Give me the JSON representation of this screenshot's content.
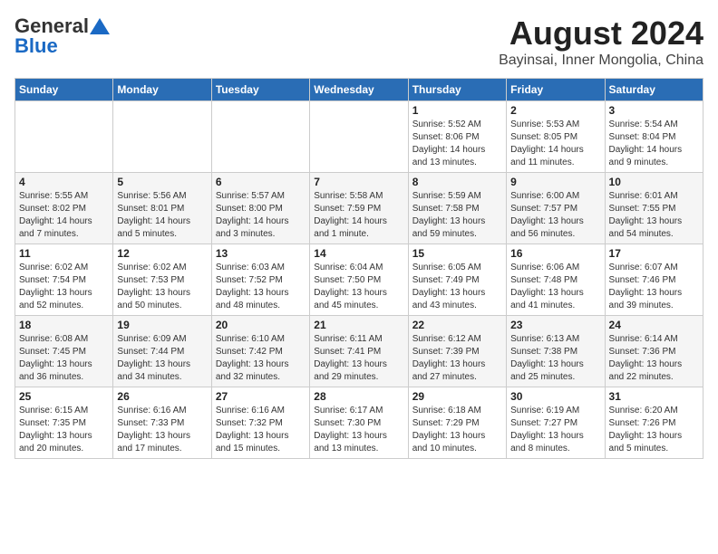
{
  "header": {
    "logo_general": "General",
    "logo_blue": "Blue",
    "title": "August 2024",
    "location": "Bayinsai, Inner Mongolia, China"
  },
  "weekdays": [
    "Sunday",
    "Monday",
    "Tuesday",
    "Wednesday",
    "Thursday",
    "Friday",
    "Saturday"
  ],
  "weeks": [
    [
      {
        "day": "",
        "info": ""
      },
      {
        "day": "",
        "info": ""
      },
      {
        "day": "",
        "info": ""
      },
      {
        "day": "",
        "info": ""
      },
      {
        "day": "1",
        "info": "Sunrise: 5:52 AM\nSunset: 8:06 PM\nDaylight: 14 hours\nand 13 minutes."
      },
      {
        "day": "2",
        "info": "Sunrise: 5:53 AM\nSunset: 8:05 PM\nDaylight: 14 hours\nand 11 minutes."
      },
      {
        "day": "3",
        "info": "Sunrise: 5:54 AM\nSunset: 8:04 PM\nDaylight: 14 hours\nand 9 minutes."
      }
    ],
    [
      {
        "day": "4",
        "info": "Sunrise: 5:55 AM\nSunset: 8:02 PM\nDaylight: 14 hours\nand 7 minutes."
      },
      {
        "day": "5",
        "info": "Sunrise: 5:56 AM\nSunset: 8:01 PM\nDaylight: 14 hours\nand 5 minutes."
      },
      {
        "day": "6",
        "info": "Sunrise: 5:57 AM\nSunset: 8:00 PM\nDaylight: 14 hours\nand 3 minutes."
      },
      {
        "day": "7",
        "info": "Sunrise: 5:58 AM\nSunset: 7:59 PM\nDaylight: 14 hours\nand 1 minute."
      },
      {
        "day": "8",
        "info": "Sunrise: 5:59 AM\nSunset: 7:58 PM\nDaylight: 13 hours\nand 59 minutes."
      },
      {
        "day": "9",
        "info": "Sunrise: 6:00 AM\nSunset: 7:57 PM\nDaylight: 13 hours\nand 56 minutes."
      },
      {
        "day": "10",
        "info": "Sunrise: 6:01 AM\nSunset: 7:55 PM\nDaylight: 13 hours\nand 54 minutes."
      }
    ],
    [
      {
        "day": "11",
        "info": "Sunrise: 6:02 AM\nSunset: 7:54 PM\nDaylight: 13 hours\nand 52 minutes."
      },
      {
        "day": "12",
        "info": "Sunrise: 6:02 AM\nSunset: 7:53 PM\nDaylight: 13 hours\nand 50 minutes."
      },
      {
        "day": "13",
        "info": "Sunrise: 6:03 AM\nSunset: 7:52 PM\nDaylight: 13 hours\nand 48 minutes."
      },
      {
        "day": "14",
        "info": "Sunrise: 6:04 AM\nSunset: 7:50 PM\nDaylight: 13 hours\nand 45 minutes."
      },
      {
        "day": "15",
        "info": "Sunrise: 6:05 AM\nSunset: 7:49 PM\nDaylight: 13 hours\nand 43 minutes."
      },
      {
        "day": "16",
        "info": "Sunrise: 6:06 AM\nSunset: 7:48 PM\nDaylight: 13 hours\nand 41 minutes."
      },
      {
        "day": "17",
        "info": "Sunrise: 6:07 AM\nSunset: 7:46 PM\nDaylight: 13 hours\nand 39 minutes."
      }
    ],
    [
      {
        "day": "18",
        "info": "Sunrise: 6:08 AM\nSunset: 7:45 PM\nDaylight: 13 hours\nand 36 minutes."
      },
      {
        "day": "19",
        "info": "Sunrise: 6:09 AM\nSunset: 7:44 PM\nDaylight: 13 hours\nand 34 minutes."
      },
      {
        "day": "20",
        "info": "Sunrise: 6:10 AM\nSunset: 7:42 PM\nDaylight: 13 hours\nand 32 minutes."
      },
      {
        "day": "21",
        "info": "Sunrise: 6:11 AM\nSunset: 7:41 PM\nDaylight: 13 hours\nand 29 minutes."
      },
      {
        "day": "22",
        "info": "Sunrise: 6:12 AM\nSunset: 7:39 PM\nDaylight: 13 hours\nand 27 minutes."
      },
      {
        "day": "23",
        "info": "Sunrise: 6:13 AM\nSunset: 7:38 PM\nDaylight: 13 hours\nand 25 minutes."
      },
      {
        "day": "24",
        "info": "Sunrise: 6:14 AM\nSunset: 7:36 PM\nDaylight: 13 hours\nand 22 minutes."
      }
    ],
    [
      {
        "day": "25",
        "info": "Sunrise: 6:15 AM\nSunset: 7:35 PM\nDaylight: 13 hours\nand 20 minutes."
      },
      {
        "day": "26",
        "info": "Sunrise: 6:16 AM\nSunset: 7:33 PM\nDaylight: 13 hours\nand 17 minutes."
      },
      {
        "day": "27",
        "info": "Sunrise: 6:16 AM\nSunset: 7:32 PM\nDaylight: 13 hours\nand 15 minutes."
      },
      {
        "day": "28",
        "info": "Sunrise: 6:17 AM\nSunset: 7:30 PM\nDaylight: 13 hours\nand 13 minutes."
      },
      {
        "day": "29",
        "info": "Sunrise: 6:18 AM\nSunset: 7:29 PM\nDaylight: 13 hours\nand 10 minutes."
      },
      {
        "day": "30",
        "info": "Sunrise: 6:19 AM\nSunset: 7:27 PM\nDaylight: 13 hours\nand 8 minutes."
      },
      {
        "day": "31",
        "info": "Sunrise: 6:20 AM\nSunset: 7:26 PM\nDaylight: 13 hours\nand 5 minutes."
      }
    ]
  ]
}
